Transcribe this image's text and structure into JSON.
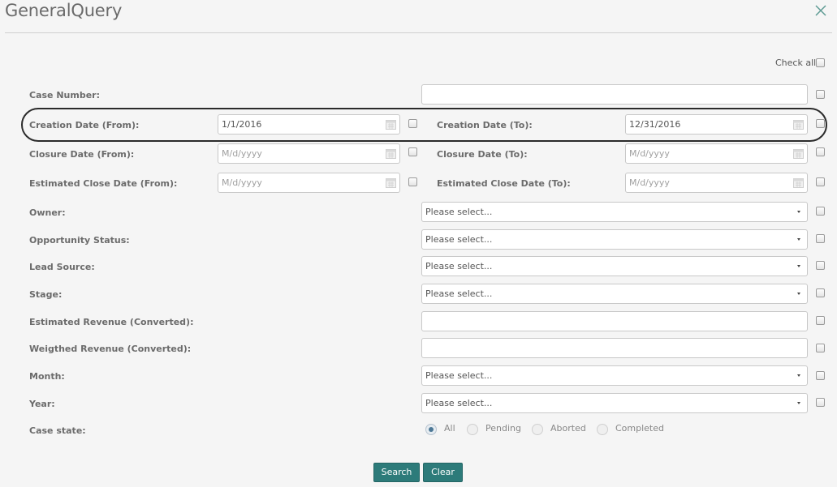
{
  "dialog": {
    "title": "GeneralQuery"
  },
  "check_all": {
    "label": "Check all"
  },
  "fields": {
    "case_number": {
      "label": "Case Number:",
      "value": ""
    },
    "creation_from": {
      "label": "Creation Date (From):",
      "value": "1/1/2016",
      "placeholder": "M/d/yyyy"
    },
    "creation_to": {
      "label": "Creation Date (To):",
      "value": "12/31/2016",
      "placeholder": "M/d/yyyy"
    },
    "closure_from": {
      "label": "Closure Date (From):",
      "value": "",
      "placeholder": "M/d/yyyy"
    },
    "closure_to": {
      "label": "Closure Date (To):",
      "value": "",
      "placeholder": "M/d/yyyy"
    },
    "est_close_from": {
      "label": "Estimated Close Date (From):",
      "value": "",
      "placeholder": "M/d/yyyy"
    },
    "est_close_to": {
      "label": "Estimated Close Date (To):",
      "value": "",
      "placeholder": "M/d/yyyy"
    },
    "owner": {
      "label": "Owner:",
      "selected": "Please select..."
    },
    "opportunity_status": {
      "label": "Opportunity Status:",
      "selected": "Please select..."
    },
    "lead_source": {
      "label": "Lead Source:",
      "selected": "Please select..."
    },
    "stage": {
      "label": "Stage:",
      "selected": "Please select..."
    },
    "est_revenue": {
      "label": "Estimated Revenue (Converted):",
      "value": ""
    },
    "weighted_revenue": {
      "label": "Weigthed Revenue (Converted):",
      "value": ""
    },
    "month": {
      "label": "Month:",
      "selected": "Please select..."
    },
    "year": {
      "label": "Year:",
      "selected": "Please select..."
    }
  },
  "case_state": {
    "label": "Case state:",
    "options": [
      "All",
      "Pending",
      "Aborted",
      "Completed"
    ],
    "selected": "All"
  },
  "buttons": {
    "search": "Search",
    "clear": "Clear"
  },
  "icons": {
    "close": "close-icon",
    "calendar": "calendar-icon",
    "dropdown": "caret-down-icon"
  },
  "colors": {
    "accent": "#2d7b7a",
    "radio_selected": "#4d7896",
    "background": "#f5f5f5"
  }
}
